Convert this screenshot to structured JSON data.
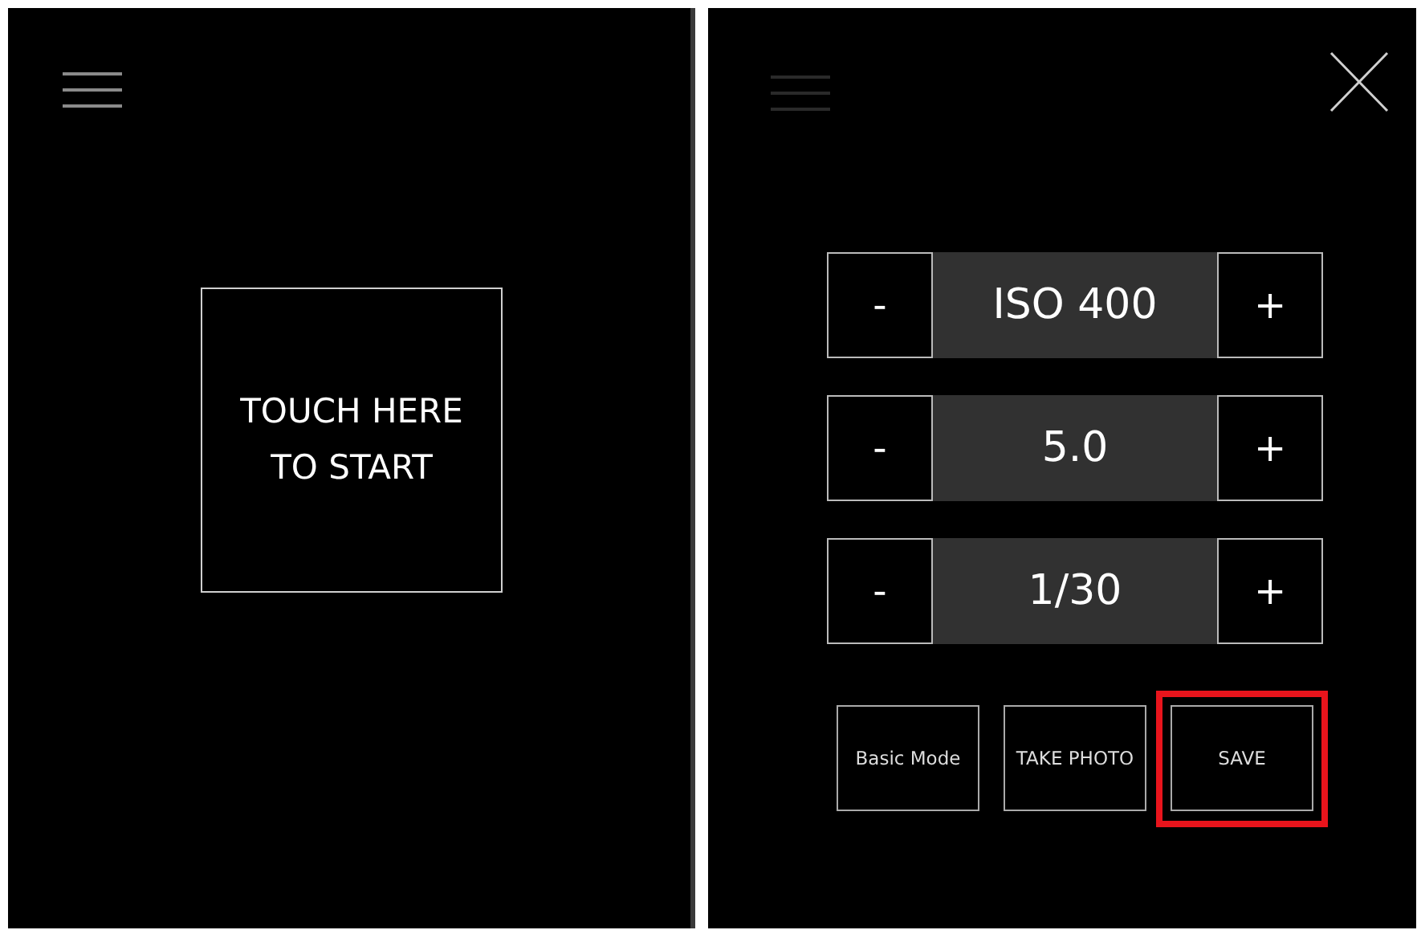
{
  "left_panel": {
    "start_button": {
      "label": "TOUCH HERE TO START"
    }
  },
  "right_panel": {
    "settings": [
      {
        "decrement": "-",
        "value": "ISO 400",
        "increment": "+"
      },
      {
        "decrement": "-",
        "value": "5.0",
        "increment": "+"
      },
      {
        "decrement": "-",
        "value": "1/30",
        "increment": "+"
      }
    ],
    "buttons": [
      {
        "label": "Basic Mode",
        "highlighted": false
      },
      {
        "label": "TAKE PHOTO",
        "highlighted": false
      },
      {
        "label": "SAVE",
        "highlighted": true
      }
    ]
  }
}
